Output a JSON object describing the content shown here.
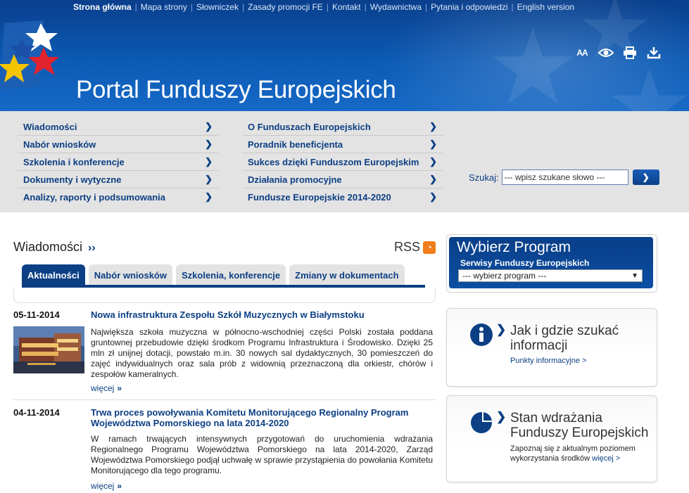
{
  "topnav": [
    "Strona główna",
    "Mapa strony",
    "Słowniczek",
    "Zasady promocji FE",
    "Kontakt",
    "Wydawnictwa",
    "Pytania i odpowiedzi",
    "English version"
  ],
  "site_title": "Portal Funduszy Europejskich",
  "tools": {
    "font_size_label": "AA"
  },
  "menu": {
    "left": [
      "Wiadomości",
      "Nabór wniosków",
      "Szkolenia i konferencje",
      "Dokumenty i wytyczne",
      "Analizy, raporty i podsumowania"
    ],
    "right": [
      "O Funduszach Europejskich",
      "Poradnik beneficjenta",
      "Sukces dzięki Funduszom Europejskim",
      "Działania promocyjne",
      "Fundusze Europejskie 2014-2020"
    ]
  },
  "search": {
    "label": "Szukaj:",
    "value": "--- wpisz szukane słowo ---"
  },
  "news": {
    "heading": "Wiadomości",
    "rss": "RSS",
    "tabs": [
      "Aktualności",
      "Nabór wniosków",
      "Szkolenia, konferencje",
      "Zmiany w dokumentach"
    ],
    "articles": [
      {
        "date": "05-11-2014",
        "title": "Nowa infrastruktura Zespołu Szkół Muzycznych w Białymstoku",
        "body": "Największa szkoła muzyczna w północno-wschodniej części Polski została poddana gruntownej przebudowie dzięki środkom Programu Infrastruktura i Środowisko. Dzięki 25 mln zł unijnej dotacji, powstało m.in. 30 nowych sal dydaktycznych, 30 pomieszczeń do zajęć indywidualnych oraz sala prób z widownią przeznaczoną dla orkiestr, chórów i zespołów kameralnych.",
        "more": "więcej"
      },
      {
        "date": "04-11-2014",
        "title": "Trwa proces powoływania Komitetu Monitorującego Regionalny Program Województwa Pomorskiego na lata 2014-2020",
        "body": "W ramach trwających intensywnych przygotowań do uruchomienia wdrażania Regionalnego Programu Województwa Pomorskiego na lata 2014-2020, Zarząd Województwa Pomorskiego podjął uchwałę w sprawie przystąpienia do powołania Komitetu Monitorującego dla tego programu.",
        "more": "więcej"
      }
    ]
  },
  "program": {
    "title": "Wybierz Program",
    "subtitle": "Serwisy Funduszy Europejskich",
    "select_value": "--- wybierz program ---"
  },
  "info_box": {
    "title": "Jak i gdzie szukać informacji",
    "link": "Punkty informacyjne >"
  },
  "status_box": {
    "title": "Stan wdrażania Funduszy Europejskich",
    "text": "Zapoznaj się z aktualnym poziomem wykorzystania środków",
    "link": "więcej >"
  },
  "colors": {
    "brand_blue": "#0c3f84",
    "rss_orange": "#f27d1a"
  }
}
